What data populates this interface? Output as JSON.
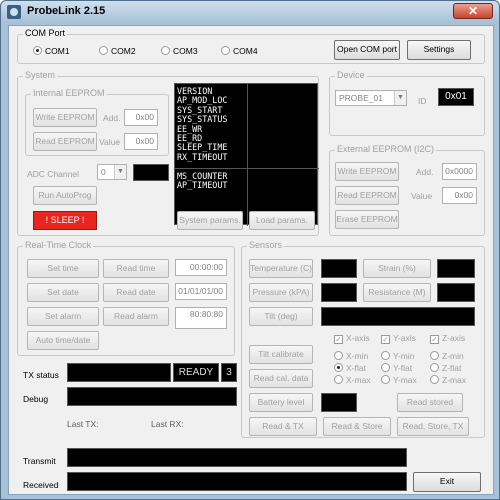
{
  "window": {
    "title": "ProbeLink 2.15",
    "close_glyph": "✕"
  },
  "com": {
    "group_label": "COM Port",
    "ports": [
      "COM1",
      "COM2",
      "COM3",
      "COM4"
    ],
    "selected": "COM1",
    "open_label": "Open COM port",
    "settings_label": "Settings"
  },
  "system": {
    "group_label": "System",
    "internal_eeprom": {
      "group_label": "Internal EEPROM",
      "write_label": "Write EEPROM",
      "read_label": "Read EEPROM",
      "add_label": "Add.",
      "add_value": "0x00",
      "value_label": "Value",
      "value_value": "0x00"
    },
    "adc_label": "ADC Channel",
    "adc_value": "0",
    "run_autoprog_label": "Run AutoProg",
    "sleep_label": "! SLEEP !",
    "status_list": [
      "VERSION",
      "AP_MOD_LOC",
      "SYS_START",
      "SYS_STATUS",
      "EE_WR",
      "EE_RD",
      "SLEEP_TIME",
      "RX_TIMEOUT"
    ],
    "status_list_2": [
      "MS_COUNTER",
      "AP_TIMEOUT"
    ],
    "system_params_label": "System params.",
    "load_params_label": "Load params."
  },
  "device": {
    "group_label": "Device",
    "selected": "PROBE_01",
    "id_label": "ID",
    "id_value": "0x01"
  },
  "external_eeprom": {
    "group_label": "External EEPROM (I2C)",
    "write_label": "Write EEPROM",
    "read_label": "Read EEPROM",
    "erase_label": "Erase EEPROM",
    "add_label": "Add.",
    "add_value": "0x0000",
    "value_label": "Value",
    "value_value": "0x00"
  },
  "rtc": {
    "group_label": "Real-Time Clock",
    "set_time": "Set time",
    "read_time": "Read time",
    "time_value": "00:00:00",
    "set_date": "Set date",
    "read_date": "Read date",
    "date_value": "01/01/01/00",
    "set_alarm": "Set alarm",
    "read_alarm": "Read alarm",
    "alarm_value": "80:80:80",
    "auto_label": "Auto time/date"
  },
  "sensors": {
    "group_label": "Sensors",
    "temperature_label": "Temperature (C)",
    "strain_label": "Strain (%)",
    "pressure_label": "Pressure (kPA)",
    "resistance_label": "Resistance (M)",
    "tilt_label": "Tilt (deg)",
    "axes": [
      "X-axis",
      "Y-axis",
      "Z-axis"
    ],
    "tilt_calibrate_label": "Tilt calibrate",
    "read_cal_label": "Read cal. data",
    "battery_label": "Battery level",
    "read_stored_label": "Read stored",
    "cal_options": [
      [
        "X-min",
        "Y-min",
        "Z-min"
      ],
      [
        "X-flat",
        "Y-flat",
        "Z-flat"
      ],
      [
        "X-max",
        "Y-max",
        "Z-max"
      ]
    ],
    "read_tx_label": "Read & TX",
    "read_store_label": "Read & Store",
    "read_store_tx_label": "Read, Store, TX"
  },
  "status": {
    "tx_label": "TX status",
    "ready_text": "READY",
    "count_text": "3",
    "debug_label": "Debug",
    "last_tx_label": "Last TX:",
    "last_rx_label": "Last RX:",
    "transmit_label": "Transmit",
    "received_label": "Received",
    "exit_label": "Exit"
  }
}
